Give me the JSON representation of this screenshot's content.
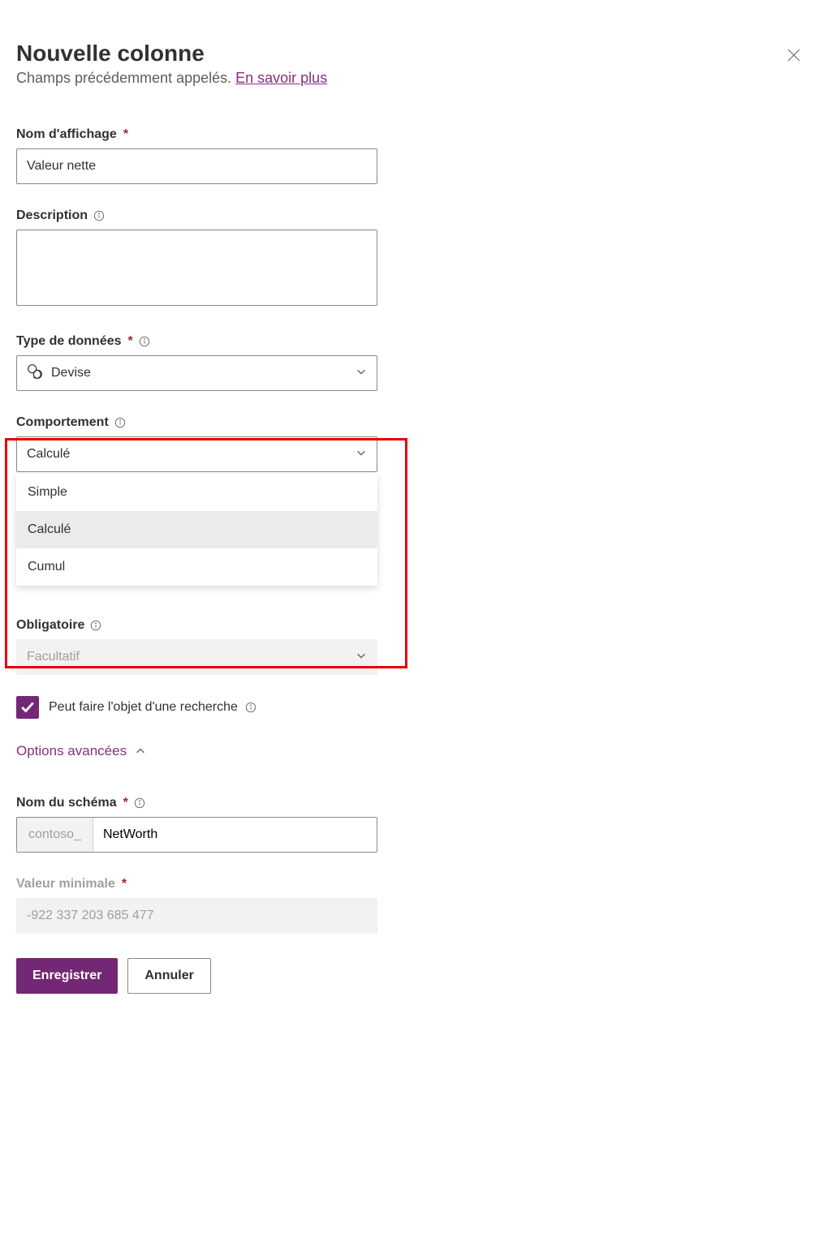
{
  "header": {
    "title": "Nouvelle colonne",
    "subtitle_prefix": "Champs précédemment appelés. ",
    "learn_more": "En savoir plus"
  },
  "fields": {
    "display_name": {
      "label": "Nom d'affichage",
      "value": "Valeur nette"
    },
    "description": {
      "label": "Description",
      "value": ""
    },
    "data_type": {
      "label": "Type de données",
      "value": "Devise"
    },
    "behavior": {
      "label": "Comportement",
      "value": "Calculé",
      "options": [
        "Simple",
        "Calculé",
        "Cumul"
      ],
      "selected_index": 1
    },
    "required_field": {
      "label": "Obligatoire",
      "value": "Facultatif"
    },
    "searchable": {
      "label": "Peut faire l'objet d'une recherche"
    },
    "advanced_toggle": "Options avancées",
    "schema_name": {
      "label": "Nom du schéma",
      "prefix": "contoso_",
      "value": "NetWorth"
    },
    "min_value": {
      "label": "Valeur minimale",
      "value": "-922 337 203 685 477"
    }
  },
  "footer": {
    "save": "Enregistrer",
    "cancel": "Annuler"
  }
}
